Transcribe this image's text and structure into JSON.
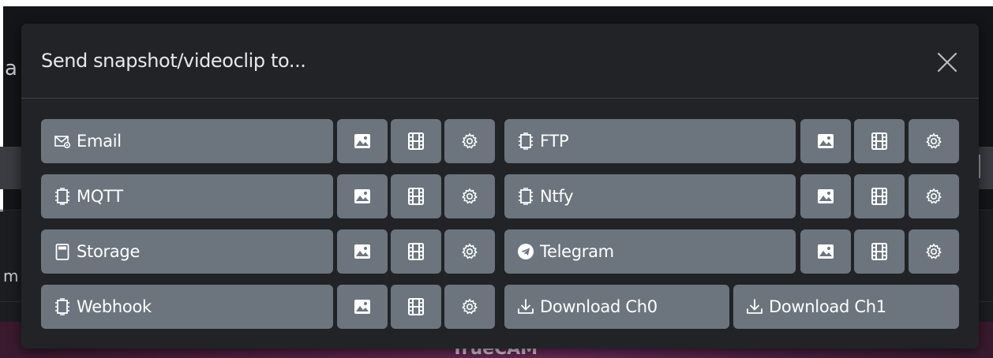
{
  "background": {
    "fragment_left_top": "a",
    "fragment_left_mid": "m",
    "fragment_bottom_brand": "TrueCAM"
  },
  "modal": {
    "title": "Send snapshot/videoclip to...",
    "close_label": "×",
    "rows": [
      {
        "left": {
          "label": "Email",
          "icon": "envelope-image-icon"
        },
        "right": {
          "label": "FTP",
          "icon": "chip-icon"
        }
      },
      {
        "left": {
          "label": "MQTT",
          "icon": "chip-icon"
        },
        "right": {
          "label": "Ntfy",
          "icon": "chip-icon"
        }
      },
      {
        "left": {
          "label": "Storage",
          "icon": "sd-card-icon"
        },
        "right": {
          "label": "Telegram",
          "icon": "telegram-icon"
        }
      },
      {
        "left": {
          "label": "Webhook",
          "icon": "chip-icon"
        },
        "download_ch0": "Download Ch0",
        "download_ch1": "Download Ch1"
      }
    ]
  },
  "colors": {
    "modal_bg": "#212327",
    "button_bg": "#6c757d",
    "title_text": "#e6e8eb",
    "button_text": "#ffffff"
  }
}
